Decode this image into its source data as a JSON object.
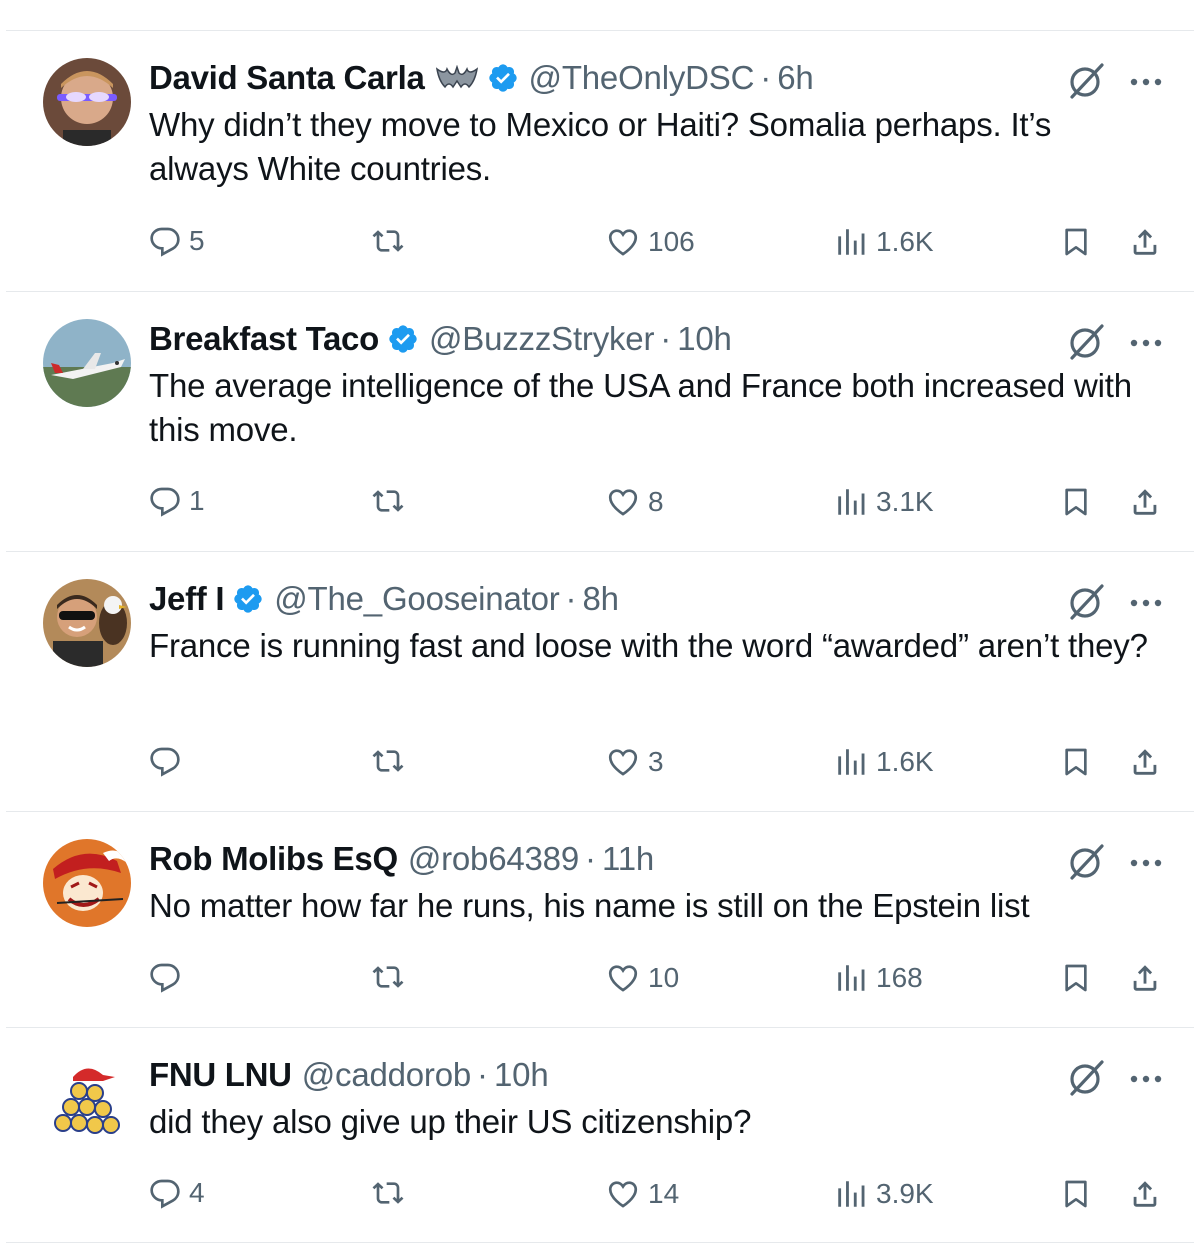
{
  "replies": [
    {
      "name": "David Santa Carla",
      "verified": true,
      "emoji": "bat-icon",
      "handle": "@TheOnlyDSC",
      "separator": "·",
      "time": "6h",
      "text": "Why didn’t they move to Mexico or Haiti? Somalia perhaps. It’s always White countries.",
      "replies_count": "5",
      "retweets_count": "",
      "likes_count": "106",
      "views_count": "1.6K",
      "avatar": "avatar-laser-eyes"
    },
    {
      "name": "Breakfast Taco",
      "verified": true,
      "handle": "@BuzzzStryker",
      "separator": "·",
      "time": "10h",
      "text": "The average intelligence of the USA and France both increased with this move.",
      "replies_count": "1",
      "retweets_count": "",
      "likes_count": "8",
      "views_count": "3.1K",
      "avatar": "avatar-jet-plane"
    },
    {
      "name": "Jeff I",
      "verified": true,
      "handle": "@The_Gooseinator",
      "separator": "·",
      "time": "8h",
      "text": "France is running fast and loose with the word “awarded” aren’t they?",
      "replies_count": "",
      "retweets_count": "",
      "likes_count": "3",
      "views_count": "1.6K",
      "avatar": "avatar-man-with-eagle"
    },
    {
      "name": "Rob Molibs EsQ",
      "verified": false,
      "handle": "@rob64389",
      "separator": "·",
      "time": "11h",
      "text": "No matter how far he runs, his name is still on the Epstein list",
      "replies_count": "",
      "retweets_count": "",
      "likes_count": "10",
      "views_count": "168",
      "avatar": "avatar-buccaneer"
    },
    {
      "name": "FNU LNU",
      "verified": false,
      "handle": "@caddorob",
      "separator": "·",
      "time": "10h",
      "text": "did they also give up their US citizenship?",
      "replies_count": "4",
      "retweets_count": "",
      "likes_count": "14",
      "views_count": "3.9K",
      "avatar": "avatar-red-hat-pile"
    }
  ],
  "colors": {
    "text": "#0f1419",
    "secondary": "#536471",
    "verified": "#1d9bf0",
    "divider": "#e6e9ec"
  }
}
